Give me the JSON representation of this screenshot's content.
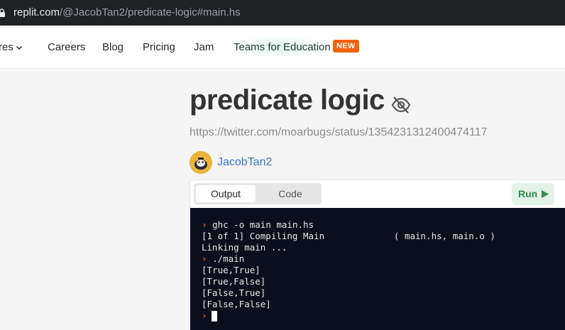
{
  "address_bar": {
    "host": "replit.com",
    "path": "/@JacobTan2/predicate-logic#main.hs"
  },
  "nav": {
    "items": [
      {
        "label": "res",
        "has_chevron": true
      },
      {
        "label": "Careers"
      },
      {
        "label": "Blog"
      },
      {
        "label": "Pricing"
      },
      {
        "label": "Jam"
      },
      {
        "label": "Teams for Education"
      }
    ],
    "badge": "NEW"
  },
  "repl": {
    "title": "predicate logic",
    "visibility_icon": "eye-slash-icon",
    "description": "https://twitter.com/moarbugs/status/1354231312400474117",
    "author": "JacobTan2"
  },
  "embed": {
    "tabs": [
      {
        "label": "Output",
        "active": true
      },
      {
        "label": "Code",
        "active": false
      }
    ],
    "run_label": "Run"
  },
  "console": {
    "prompt_symbol": "›",
    "lines": [
      {
        "prompt": true,
        "text": "ghc -o main main.hs"
      },
      {
        "prompt": false,
        "text": "[1 of 1] Compiling Main             ( main.hs, main.o )"
      },
      {
        "prompt": false,
        "text": "Linking main ..."
      },
      {
        "prompt": true,
        "text": "./main"
      },
      {
        "prompt": false,
        "text": "[True,True]"
      },
      {
        "prompt": false,
        "text": "[True,False]"
      },
      {
        "prompt": false,
        "text": "[False,True]"
      },
      {
        "prompt": false,
        "text": "[False,False]"
      },
      {
        "prompt": true,
        "text": "",
        "cursor": true
      }
    ]
  },
  "colors": {
    "badge": "#f26207",
    "run_text": "#2f8a4c",
    "author_link": "#3a78c0",
    "console_bg": "#0b0e1c",
    "prompt": "#f26207"
  }
}
